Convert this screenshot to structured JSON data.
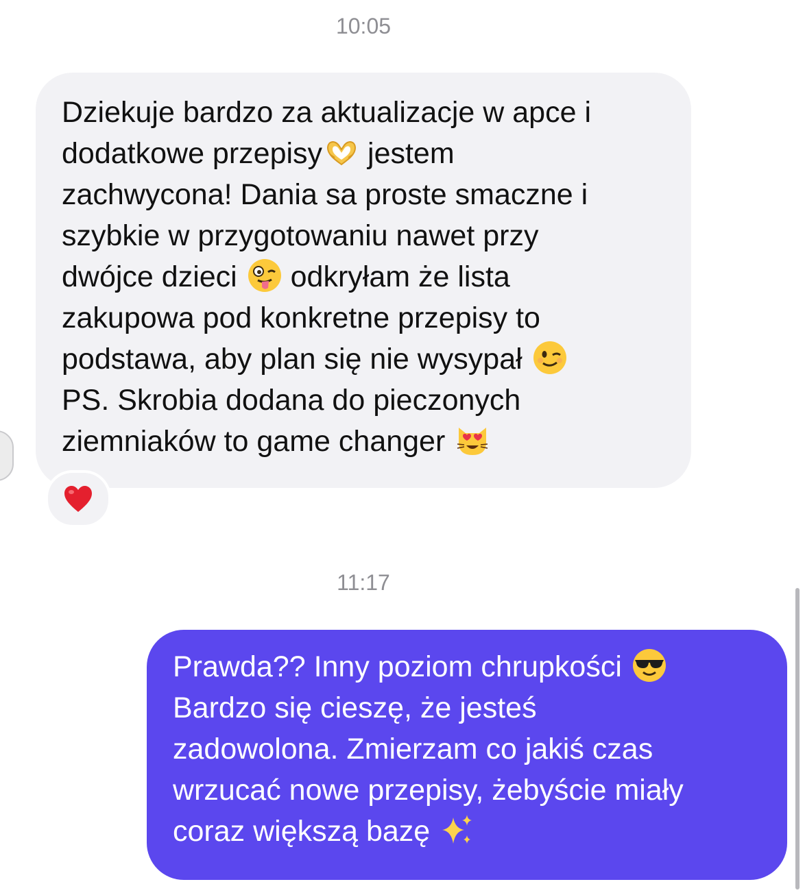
{
  "conversation": {
    "timestamp_1": "10:05",
    "timestamp_2": "11:17",
    "incoming_message": {
      "lines": [
        "Dziekuje bardzo za aktualizacje w apce i",
        "dodatkowe przepisy",
        " jestem",
        "zachwycona! Dania sa proste smaczne i",
        "szybkie w przygotowaniu nawet przy",
        "dwójce dzieci ",
        " odkryłam że lista",
        "zakupowa pod konkretne przepisy to",
        "podstawa, aby plan się nie wysypał ",
        "PS. Skrobia dodana do pieczonych",
        "ziemniaków to game changer "
      ],
      "emojis": [
        "heart-hands-emoji",
        "zany-face-emoji",
        "winking-face-emoji",
        "heart-eyes-cat-emoji"
      ],
      "reaction": "red-heart-emoji"
    },
    "outgoing_message": {
      "lines": [
        "Prawda?? Inny poziom chrupkości ",
        "Bardzo się cieszę, że jesteś",
        "zadowolona. Zmierzam co jakiś czas",
        "wrzucać nowe przepisy, żebyście miały",
        "coraz większą bazę "
      ],
      "emojis": [
        "sunglasses-face-emoji",
        "sparkles-emoji"
      ]
    },
    "colors": {
      "incoming_bubble": "#f2f2f5",
      "outgoing_bubble": "#5b47ee",
      "timestamp": "#8e8e93"
    }
  }
}
